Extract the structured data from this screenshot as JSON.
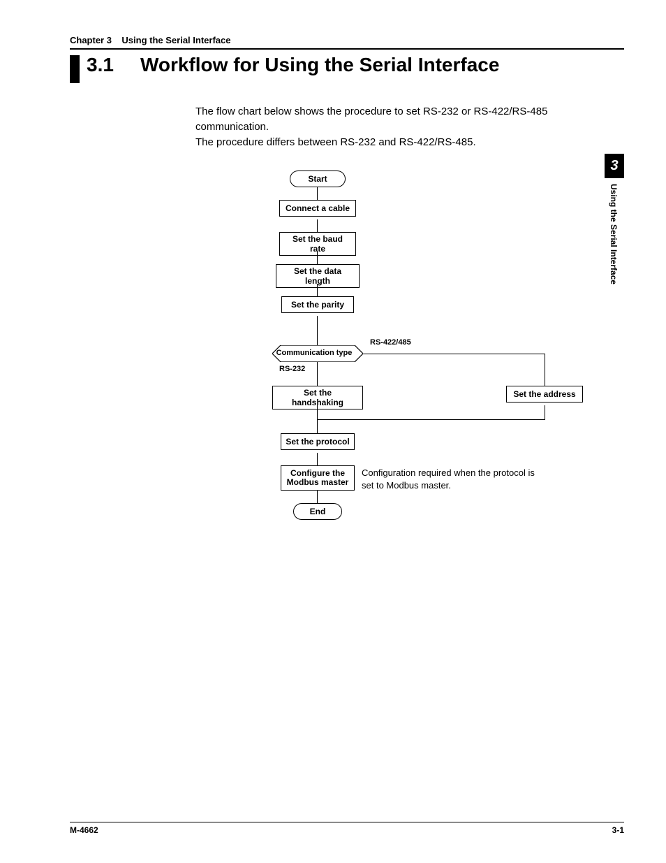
{
  "header": {
    "chapter": "Chapter 3",
    "chapter_title": "Using the Serial Interface"
  },
  "section": {
    "number": "3.1",
    "title": "Workflow for Using the Serial Interface"
  },
  "intro": {
    "line1": "The flow chart below shows the procedure to set RS-232 or RS-422/RS-485 communication.",
    "line2": "The procedure differs between RS-232 and RS-422/RS-485."
  },
  "flow": {
    "start": "Start",
    "cable": "Connect a cable",
    "baud": "Set the baud rate",
    "datalen": "Set the data length",
    "parity": "Set the parity",
    "commtype": "Communication type",
    "rs232": "RS-232",
    "rs422": "RS-422/485",
    "handshake": "Set the handshaking",
    "address": "Set the address",
    "protocol": "Set the protocol",
    "modbus": "Configure the Modbus master",
    "modbus_note": "Configuration required when the protocol is set to Modbus master.",
    "end": "End"
  },
  "sidetab": {
    "num": "3",
    "text": "Using the Serial Interface"
  },
  "footer": {
    "left": "M-4662",
    "right": "3-1"
  }
}
